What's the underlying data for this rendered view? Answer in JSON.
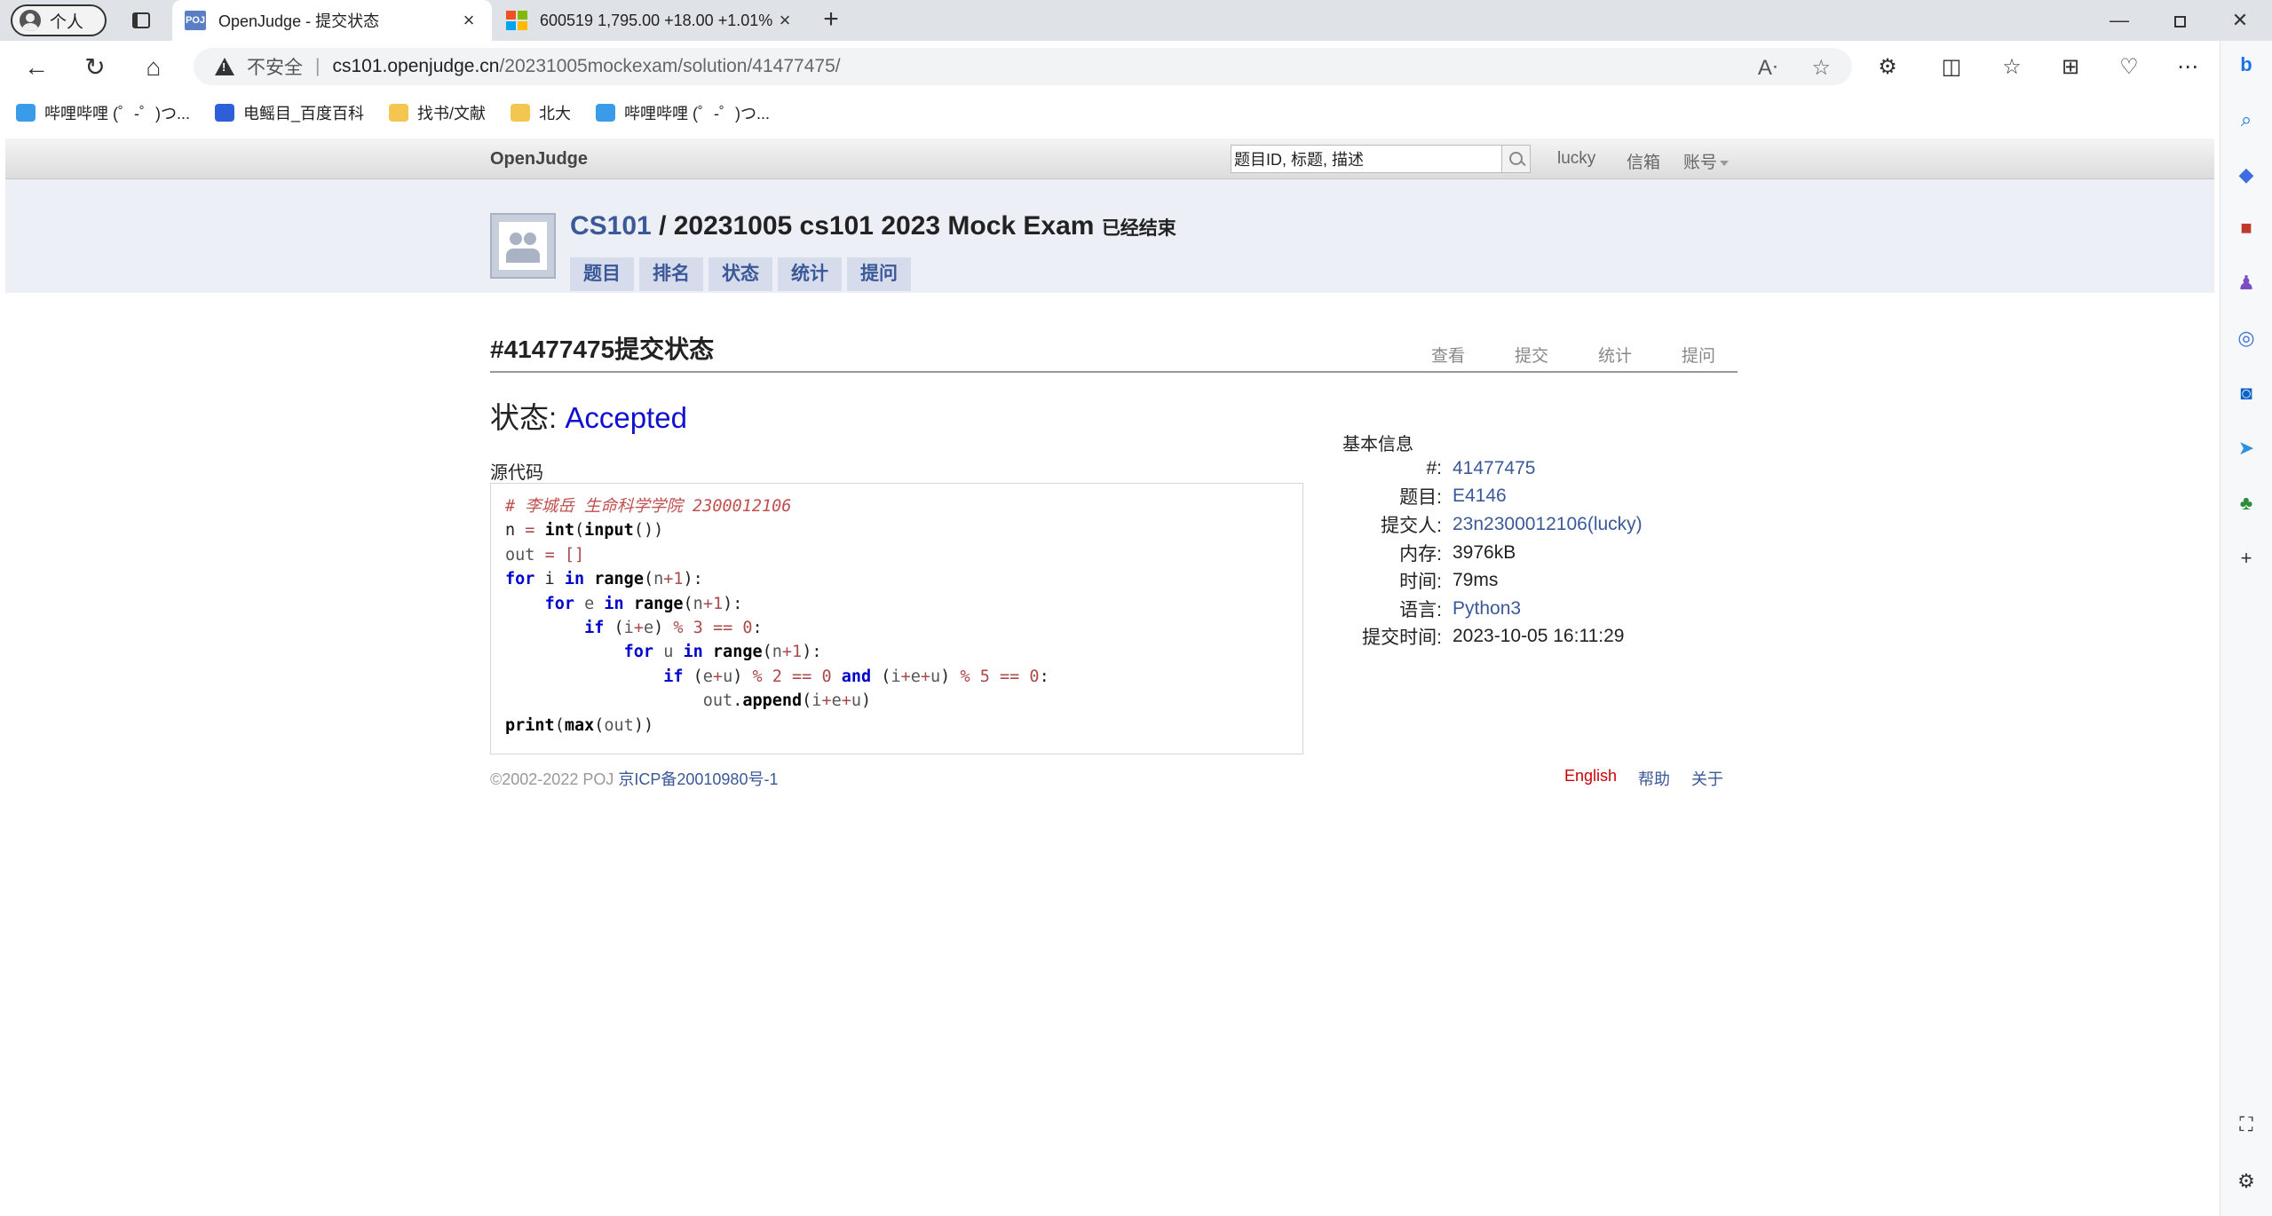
{
  "browser": {
    "profile_label": "个人",
    "tabs": [
      {
        "title": "OpenJudge - 提交状态",
        "favicon_text": "POJ"
      },
      {
        "title": "600519 1,795.00 +18.00 +1.01%"
      }
    ],
    "new_tab": "+",
    "window": {
      "minimize": "—",
      "maximize": "",
      "close": "✕"
    },
    "address": {
      "security_label": "不安全",
      "separator": "|",
      "host": "cs101.openjudge.cn",
      "path": "/20231005mockexam/solution/41477475/"
    },
    "bookmarks": [
      {
        "label": "哔哩哔哩 (゜-゜)つ...",
        "icon": "bilibili-icon"
      },
      {
        "label": "电鳐目_百度百科",
        "icon": "baidu-paw-icon"
      },
      {
        "label": "找书/文献",
        "icon": "folder-icon"
      },
      {
        "label": "北大",
        "icon": "folder-icon"
      },
      {
        "label": "哔哩哔哩 (゜-゜)つ...",
        "icon": "bilibili-icon"
      }
    ]
  },
  "oj": {
    "logo": "OpenJudge",
    "search_placeholder": "题目ID, 标题, 描述",
    "nav": {
      "user": "lucky",
      "mail": "信箱",
      "account": "账号"
    },
    "contest": {
      "course": "CS101",
      "separator": " / ",
      "name": "20231005 cs101 2023 Mock Exam",
      "ended": "已经结束",
      "tabs": [
        "题目",
        "排名",
        "状态",
        "统计",
        "提问"
      ]
    },
    "solution": {
      "title": "#41477475提交状态",
      "actions": [
        "查看",
        "提交",
        "统计",
        "提问"
      ],
      "status_label": "状态: ",
      "status_value": "Accepted",
      "source_label": "源代码"
    },
    "info": {
      "heading": "基本信息",
      "rows": [
        {
          "label": "#:",
          "value": "41477475",
          "link": true
        },
        {
          "label": "题目:",
          "value": "E4146",
          "link": true
        },
        {
          "label": "提交人:",
          "value": "23n2300012106(lucky)",
          "link": true
        },
        {
          "label": "内存:",
          "value": "3976kB",
          "link": false
        },
        {
          "label": "时间:",
          "value": "79ms",
          "link": false
        },
        {
          "label": "语言:",
          "value": "Python3",
          "link": true
        },
        {
          "label": "提交时间:",
          "value": "2023-10-05 16:11:29",
          "link": false
        }
      ]
    },
    "footer": {
      "copyright": "©2002-2022 POJ ",
      "icp": "京ICP备20010980号-1",
      "links": [
        "English",
        "帮助",
        "关于"
      ]
    }
  },
  "colors": {
    "link": "#3b5998",
    "accepted": "#1010d0",
    "english": "#cc0000"
  }
}
